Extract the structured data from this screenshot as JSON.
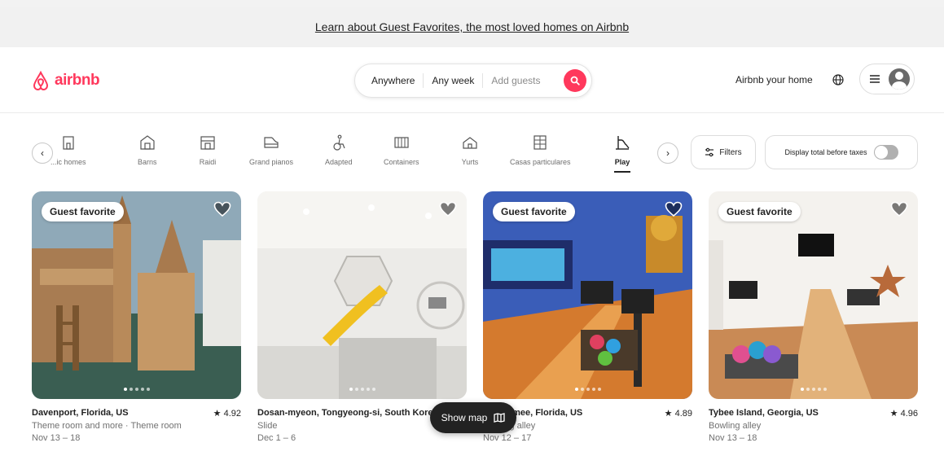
{
  "banner": {
    "text": "Learn about Guest Favorites, the most loved homes on Airbnb"
  },
  "header": {
    "logo_text": "airbnb",
    "search": {
      "where": "Anywhere",
      "when": "Any week",
      "guests": "Add guests"
    },
    "host_link": "Airbnb your home"
  },
  "categories": {
    "items": [
      {
        "label": "...ic homes",
        "icon": "house-icon"
      },
      {
        "label": "Barns",
        "icon": "barn-icon"
      },
      {
        "label": "Raidi",
        "icon": "building-icon"
      },
      {
        "label": "Grand pianos",
        "icon": "piano-icon"
      },
      {
        "label": "Adapted",
        "icon": "accessible-icon"
      },
      {
        "label": "Containers",
        "icon": "container-icon"
      },
      {
        "label": "Yurts",
        "icon": "yurt-icon"
      },
      {
        "label": "Casas particulares",
        "icon": "casa-icon"
      },
      {
        "label": "Play",
        "icon": "slide-icon",
        "active": true
      }
    ],
    "filters_label": "Filters",
    "taxes_label": "Display total before taxes"
  },
  "listings": [
    {
      "badge": "Guest favorite",
      "title": "Davenport, Florida, US",
      "rating": "★ 4.92",
      "subtitle": "Theme room and more · Theme room",
      "dates": "Nov 13 – 18"
    },
    {
      "badge": "",
      "title": "Dosan-myeon, Tongyeong-si, South Korea",
      "rating": "",
      "subtitle": "Slide",
      "dates": "Dec 1 – 6"
    },
    {
      "badge": "Guest favorite",
      "title": "Kissimmee, Florida, US",
      "rating": "★ 4.89",
      "subtitle": "Bowling alley",
      "dates": "Nov 12 – 17"
    },
    {
      "badge": "Guest favorite",
      "title": "Tybee Island, Georgia, US",
      "rating": "★ 4.96",
      "subtitle": "Bowling alley",
      "dates": "Nov 13 – 18"
    }
  ],
  "show_map": "Show map",
  "colors": {
    "brand": "#ff385c",
    "text": "#222222",
    "muted": "#717171"
  }
}
